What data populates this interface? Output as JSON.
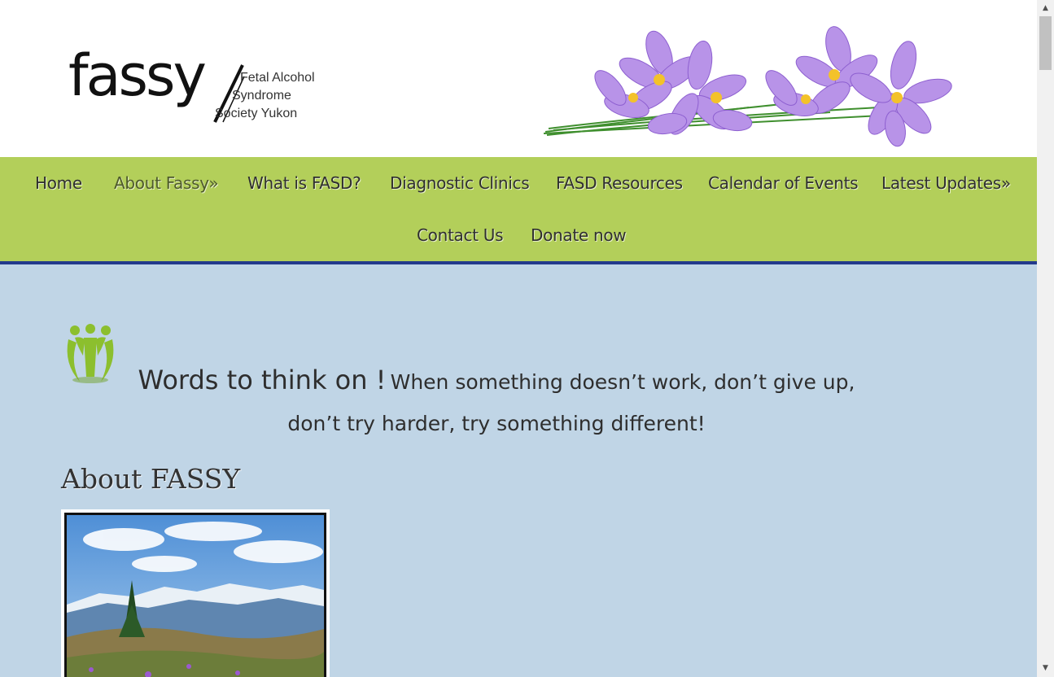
{
  "header": {
    "logo_word": "fassy",
    "logo_tagline": [
      "Fetal Alcohol",
      "Syndrome",
      "Society Yukon"
    ]
  },
  "nav": {
    "items": [
      {
        "label": "Home"
      },
      {
        "label": "About Fassy»",
        "active": true
      },
      {
        "label": "What is FASD?"
      },
      {
        "label": "Diagnostic Clinics"
      },
      {
        "label": "FASD Resources"
      },
      {
        "label": "Calendar of Events"
      },
      {
        "label": "Latest Updates»"
      },
      {
        "label": "Contact Us"
      },
      {
        "label": "Donate now"
      }
    ]
  },
  "main": {
    "quote_title": "Words to think on !",
    "quote_body": "When something doesn’t work, don’t give up, don’t try harder, try something different!",
    "about_title": "About FASSY"
  },
  "colors": {
    "nav_bg": "#b3cf5a",
    "nav_border": "#233a8c",
    "content_bg": "#c0d5e6",
    "icon_green": "#8cbf2e",
    "flower_purple": "#a77be0"
  },
  "icons": {
    "people": "people-group-icon",
    "scroll_up": "scroll-up-arrow-icon",
    "scroll_down": "scroll-down-arrow-icon"
  }
}
